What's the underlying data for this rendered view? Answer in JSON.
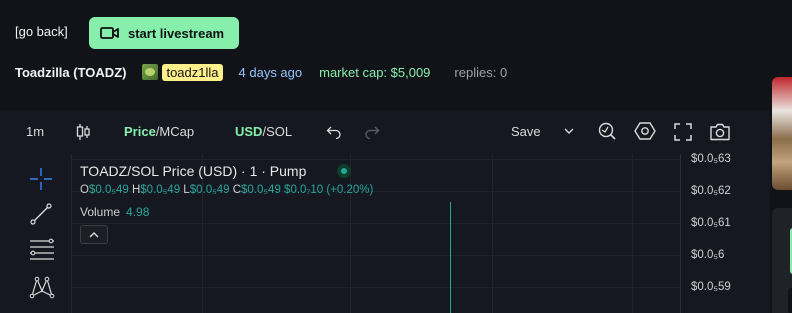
{
  "header": {
    "back_label": "[go back]",
    "livestream_label": "start livestream"
  },
  "info": {
    "coin_name": "Toadzilla (TOADZ)",
    "creator": "toadz1lla",
    "ago": "4 days ago",
    "market_cap": "market cap: $5,009",
    "replies": "replies: 0"
  },
  "toolbar": {
    "interval": "1m",
    "price_label": "Price",
    "mcap_label": "/MCap",
    "usd_label": "USD",
    "sol_label": "/SOL",
    "save_label": "Save"
  },
  "chart_legend": {
    "title": "TOADZ/SOL Price (USD) · 1 · Pump",
    "o_key": "O",
    "o_val": "$0.0₅49",
    "h_key": "H",
    "h_val": "$0.0₅49",
    "l_key": "L",
    "l_val": "$0.0₅49",
    "c_key": "C",
    "c_val": "$0.0₅49",
    "change": "$0.0₇10 (+0.20%)",
    "volume_label": "Volume",
    "volume_value": "4.98"
  },
  "price_axis": {
    "ticks": [
      "$0.0₅63",
      "$0.0₅62",
      "$0.0₅61",
      "$0.0₅6",
      "$0.0₅59"
    ]
  },
  "colors": {
    "accent": "#86efac",
    "up": "#26a69a",
    "creator_bg": "#fef08a",
    "ago": "#93c5fd"
  },
  "icons": [
    "video-camera-icon",
    "candlestick-icon",
    "undo-icon",
    "redo-icon",
    "chevron-down-icon",
    "indicator-icon",
    "settings-icon",
    "fullscreen-icon",
    "camera-icon",
    "crosshair-icon",
    "trendline-icon",
    "fib-icon",
    "pattern-icon",
    "chevron-up-icon"
  ]
}
